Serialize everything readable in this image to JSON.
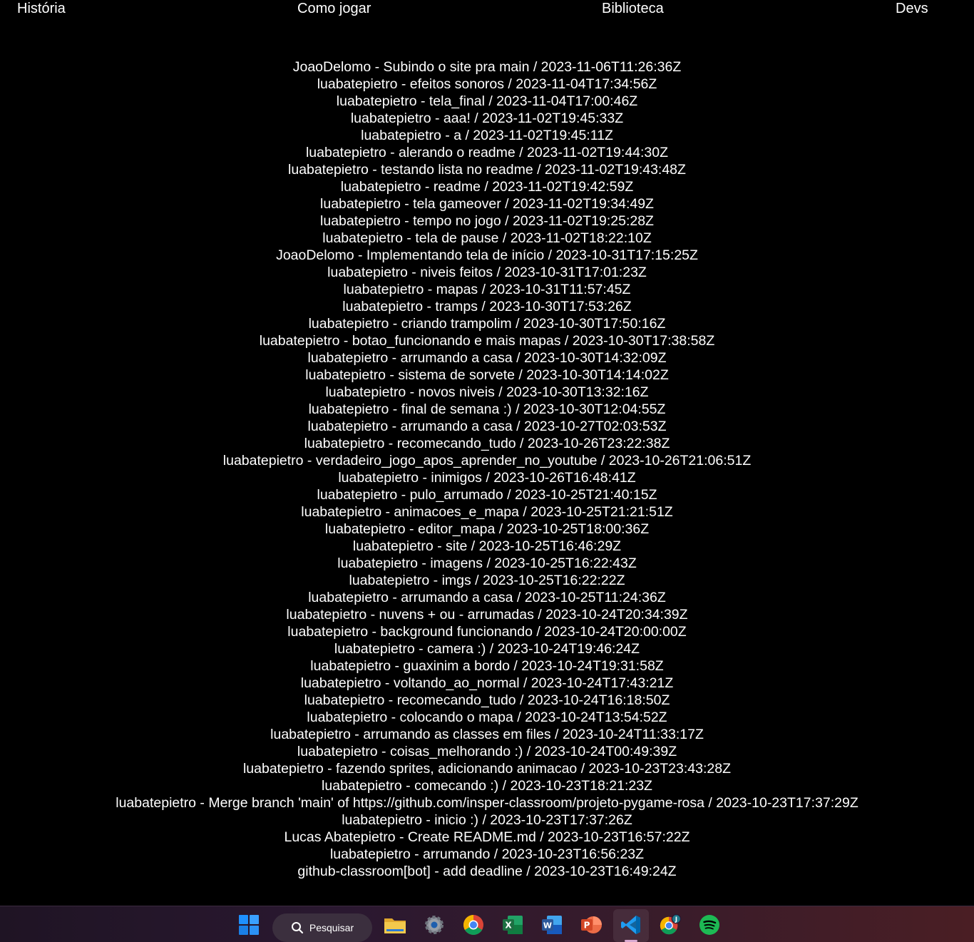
{
  "nav": {
    "historia": "História",
    "como_jogar": "Como jogar",
    "biblioteca": "Biblioteca",
    "devs": "Devs"
  },
  "commits": [
    "JoaoDelomo - Subindo o site pra main / 2023-11-06T11:26:36Z",
    "luabatepietro - efeitos sonoros / 2023-11-04T17:34:56Z",
    "luabatepietro - tela_final / 2023-11-04T17:00:46Z",
    "luabatepietro - aaa! / 2023-11-02T19:45:33Z",
    "luabatepietro - a / 2023-11-02T19:45:11Z",
    "luabatepietro - alerando o readme / 2023-11-02T19:44:30Z",
    "luabatepietro - testando lista no readme / 2023-11-02T19:43:48Z",
    "luabatepietro - readme / 2023-11-02T19:42:59Z",
    "luabatepietro - tela gameover / 2023-11-02T19:34:49Z",
    "luabatepietro - tempo no jogo / 2023-11-02T19:25:28Z",
    "luabatepietro - tela de pause / 2023-11-02T18:22:10Z",
    "JoaoDelomo - Implementando tela de início / 2023-10-31T17:15:25Z",
    "luabatepietro - niveis feitos / 2023-10-31T17:01:23Z",
    "luabatepietro - mapas / 2023-10-31T11:57:45Z",
    "luabatepietro - tramps / 2023-10-30T17:53:26Z",
    "luabatepietro - criando trampolim / 2023-10-30T17:50:16Z",
    "luabatepietro - botao_funcionando e mais mapas / 2023-10-30T17:38:58Z",
    "luabatepietro - arrumando a casa / 2023-10-30T14:32:09Z",
    "luabatepietro - sistema de sorvete / 2023-10-30T14:14:02Z",
    "luabatepietro - novos niveis / 2023-10-30T13:32:16Z",
    "luabatepietro - final de semana :) / 2023-10-30T12:04:55Z",
    "luabatepietro - arrumando a casa / 2023-10-27T02:03:53Z",
    "luabatepietro - recomecando_tudo / 2023-10-26T23:22:38Z",
    "luabatepietro - verdadeiro_jogo_apos_aprender_no_youtube / 2023-10-26T21:06:51Z",
    "luabatepietro - inimigos / 2023-10-26T16:48:41Z",
    "luabatepietro - pulo_arrumado / 2023-10-25T21:40:15Z",
    "luabatepietro - animacoes_e_mapa / 2023-10-25T21:21:51Z",
    "luabatepietro - editor_mapa / 2023-10-25T18:00:36Z",
    "luabatepietro - site / 2023-10-25T16:46:29Z",
    "luabatepietro - imagens / 2023-10-25T16:22:43Z",
    "luabatepietro - imgs / 2023-10-25T16:22:22Z",
    "luabatepietro - arrumando a casa / 2023-10-25T11:24:36Z",
    "luabatepietro - nuvens + ou - arrumadas / 2023-10-24T20:34:39Z",
    "luabatepietro - background funcionando / 2023-10-24T20:00:00Z",
    "luabatepietro - camera :) / 2023-10-24T19:46:24Z",
    "luabatepietro - guaxinim a bordo / 2023-10-24T19:31:58Z",
    "luabatepietro - voltando_ao_normal / 2023-10-24T17:43:21Z",
    "luabatepietro - recomecando_tudo / 2023-10-24T16:18:50Z",
    "luabatepietro - colocando o mapa / 2023-10-24T13:54:52Z",
    "luabatepietro - arrumando as classes em files / 2023-10-24T11:33:17Z",
    "luabatepietro - coisas_melhorando :) / 2023-10-24T00:49:39Z",
    "luabatepietro - fazendo sprites, adicionando animacao / 2023-10-23T23:43:28Z",
    "luabatepietro - comecando :) / 2023-10-23T18:21:23Z",
    "luabatepietro - Merge branch 'main' of https://github.com/insper-classroom/projeto-pygame-rosa / 2023-10-23T17:37:29Z",
    "luabatepietro - inicio :) / 2023-10-23T17:37:26Z",
    "Lucas Abatepietro - Create README.md / 2023-10-23T16:57:22Z",
    "luabatepietro - arrumando / 2023-10-23T16:56:23Z",
    "github-classroom[bot] - add deadline / 2023-10-23T16:49:24Z"
  ],
  "taskbar": {
    "search_label": "Pesquisar",
    "excel_letter": "X",
    "word_letter": "W",
    "powerpoint_letter": "P",
    "chrome_profile_letter": "J",
    "items": [
      "windows-start-icon",
      "search-icon",
      "file-explorer-icon",
      "settings-icon",
      "chrome-icon",
      "excel-icon",
      "word-icon",
      "powerpoint-icon",
      "vscode-icon",
      "chrome-profile-icon",
      "spotify-icon"
    ],
    "colors": {
      "windows": "#1e90ff",
      "explorer": "#f2c94c",
      "excel": "#1d6f42",
      "word": "#2b579a",
      "powerpoint": "#d24726",
      "vscode": "#23a9f2",
      "spotify": "#1db954",
      "active_indicator": "#d8a9d0"
    }
  }
}
